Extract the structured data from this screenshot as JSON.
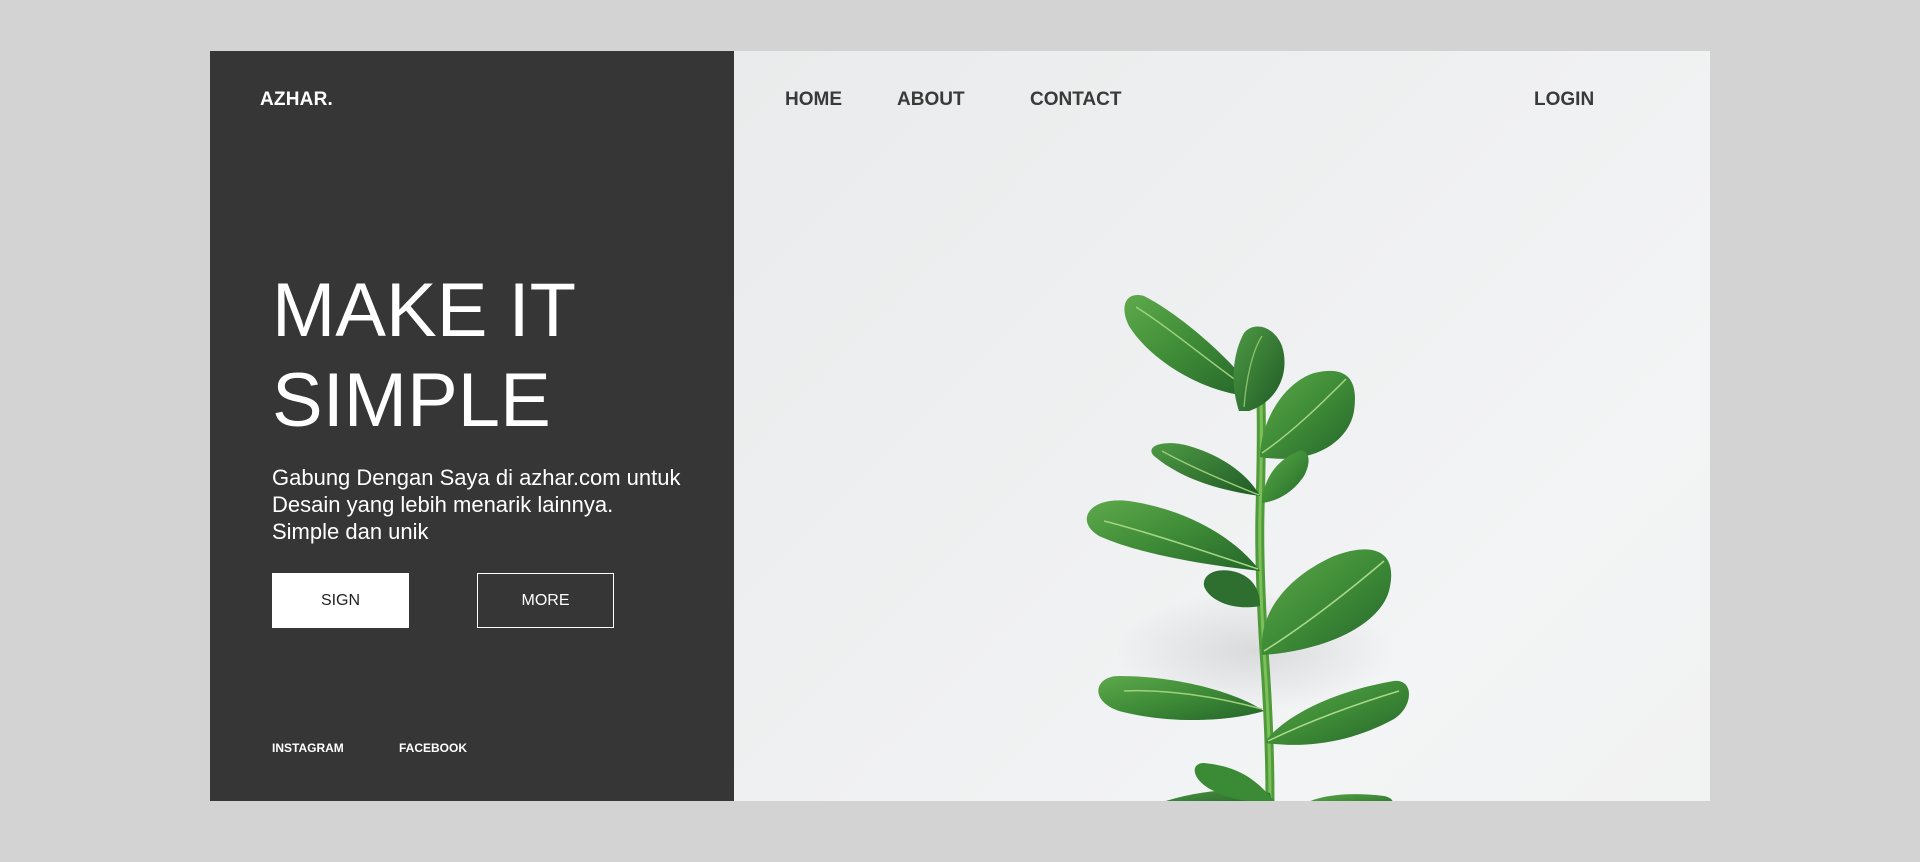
{
  "brand": "AZHAR.",
  "nav": {
    "home": "HOME",
    "about": "ABOUT",
    "contact": "CONTACT",
    "login": "LOGIN"
  },
  "hero": {
    "title_line1": "MAKE IT",
    "title_line2": "SIMPLE",
    "text_line1": "Gabung Dengan Saya di azhar.com untuk",
    "text_line2": "Desain yang lebih menarik lainnya.",
    "text_line3": "Simple dan unik"
  },
  "buttons": {
    "sign": "SIGN",
    "more": "MORE"
  },
  "social": {
    "instagram": "INSTAGRAM",
    "facebook": "FACEBOOK"
  },
  "image": {
    "subject": "green rubber plant on light grey background",
    "icon": "plant-photo"
  },
  "colors": {
    "left_panel": "#363636",
    "page_background": "#d3d3d3",
    "right_panel": "#eff0f1",
    "leaf_green": "#3f8f3a"
  }
}
